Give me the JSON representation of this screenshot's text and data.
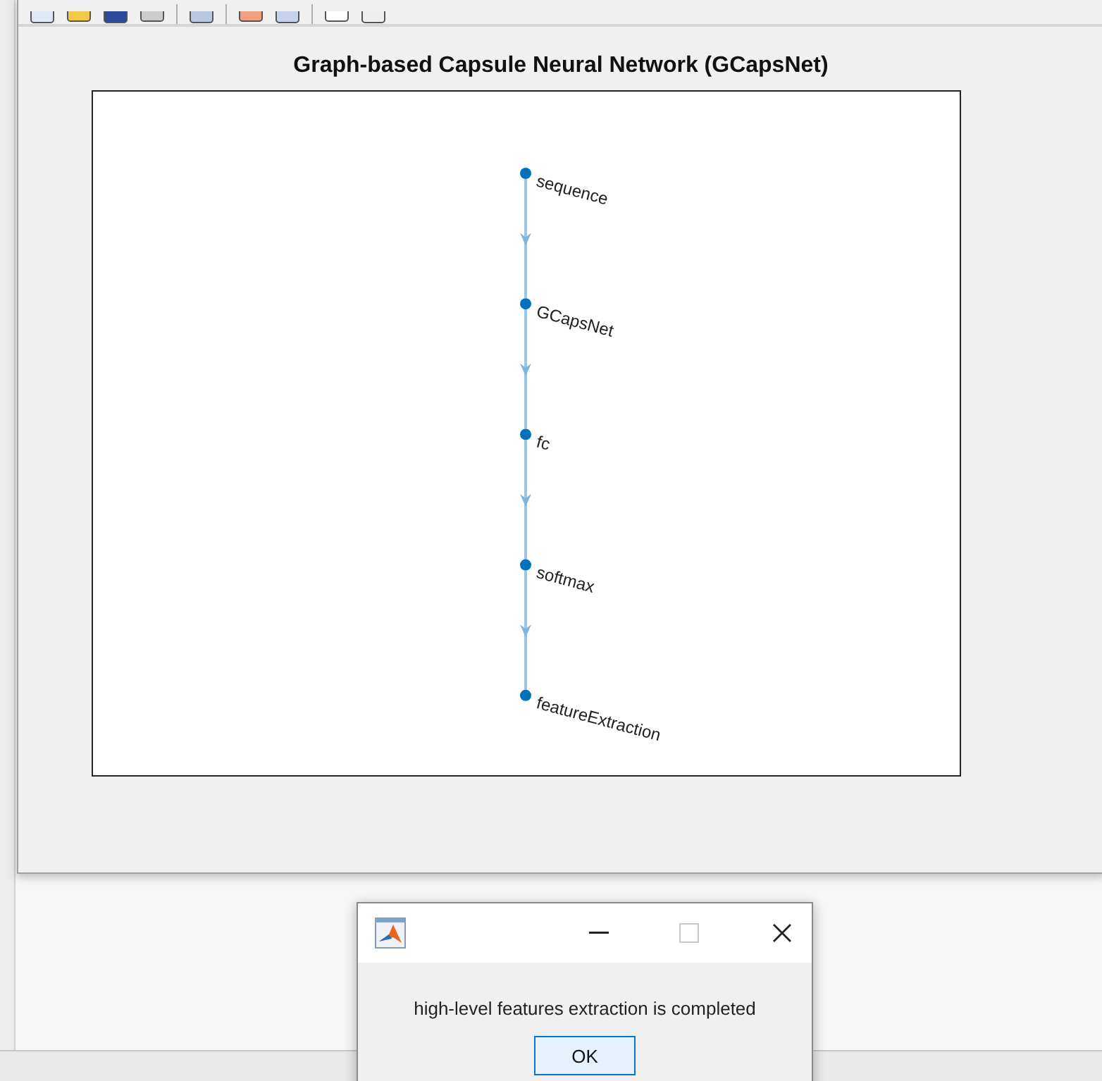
{
  "figure": {
    "title": "Graph-based Capsule Neural Network (GCapsNet)",
    "nodes": [
      {
        "label": "sequence"
      },
      {
        "label": "GCapsNet"
      },
      {
        "label": "fc"
      },
      {
        "label": "softmax"
      },
      {
        "label": "featureExtraction"
      }
    ]
  },
  "dialog": {
    "message": "high-level features extraction is completed",
    "buttons": [
      "OK"
    ]
  }
}
